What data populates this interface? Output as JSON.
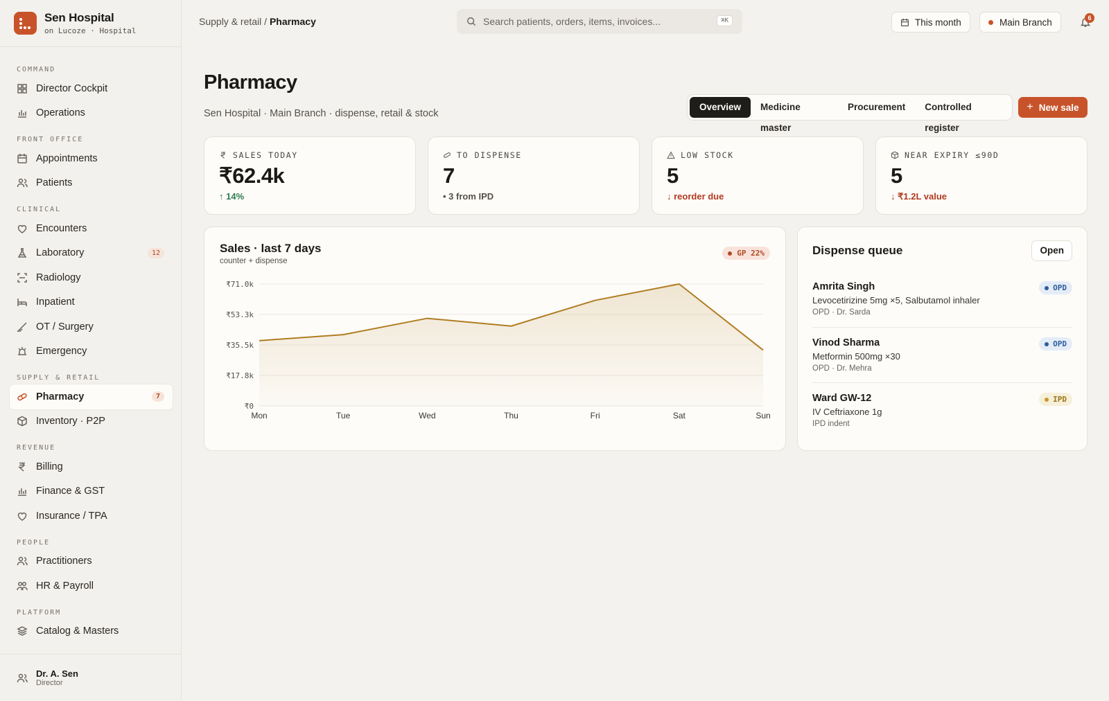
{
  "brand": {
    "name": "Sen Hospital",
    "subtitle": "on Lucoze · Hospital"
  },
  "sidebar": {
    "sections": [
      {
        "title": "COMMAND",
        "items": [
          {
            "label": "Director Cockpit",
            "icon": "grid-icon"
          },
          {
            "label": "Operations",
            "icon": "bar-chart-icon"
          }
        ]
      },
      {
        "title": "FRONT OFFICE",
        "items": [
          {
            "label": "Appointments",
            "icon": "calendar-icon"
          },
          {
            "label": "Patients",
            "icon": "users-icon"
          }
        ]
      },
      {
        "title": "CLINICAL",
        "items": [
          {
            "label": "Encounters",
            "icon": "heart-icon"
          },
          {
            "label": "Laboratory",
            "icon": "flask-icon",
            "badge": "12"
          },
          {
            "label": "Radiology",
            "icon": "scan-icon"
          },
          {
            "label": "Inpatient",
            "icon": "bed-icon"
          },
          {
            "label": "OT / Surgery",
            "icon": "scalpel-icon"
          },
          {
            "label": "Emergency",
            "icon": "siren-icon"
          }
        ]
      },
      {
        "title": "SUPPLY & RETAIL",
        "items": [
          {
            "label": "Pharmacy",
            "icon": "pill-icon",
            "badge": "7",
            "active": true
          },
          {
            "label": "Inventory · P2P",
            "icon": "box-icon"
          }
        ]
      },
      {
        "title": "REVENUE",
        "items": [
          {
            "label": "Billing",
            "icon": "rupee-icon"
          },
          {
            "label": "Finance & GST",
            "icon": "bar-chart-icon"
          },
          {
            "label": "Insurance / TPA",
            "icon": "heart-icon"
          }
        ]
      },
      {
        "title": "PEOPLE",
        "items": [
          {
            "label": "Practitioners",
            "icon": "users-icon"
          },
          {
            "label": "HR & Payroll",
            "icon": "users-icon"
          }
        ]
      },
      {
        "title": "PLATFORM",
        "items": [
          {
            "label": "Catalog & Masters",
            "icon": "layers-icon"
          }
        ]
      }
    ],
    "user": {
      "name": "Dr. A. Sen",
      "role": "Director"
    }
  },
  "topbar": {
    "breadcrumb_parent": "Supply & retail / ",
    "breadcrumb_current": "Pharmacy",
    "search_placeholder": "Search patients, orders, items, invoices...",
    "search_shortcut": "⌘K",
    "period_label": "This month",
    "branch_label": "Main Branch",
    "notification_count": "6"
  },
  "page": {
    "title": "Pharmacy",
    "subtitle": "Sen Hospital · Main Branch · dispense, retail & stock",
    "tabs": [
      "Overview",
      "Medicine master",
      "Procurement",
      "Controlled register"
    ],
    "active_tab": "Overview",
    "new_sale_label": "New sale"
  },
  "kpis": [
    {
      "label": "SALES TODAY",
      "icon": "rupee-icon",
      "value": "₹62.4k",
      "foot": "↑ 14%",
      "tone": "up"
    },
    {
      "label": "TO DISPENSE",
      "icon": "pill-icon",
      "value": "7",
      "foot": "• 3 from IPD",
      "tone": "muted"
    },
    {
      "label": "LOW STOCK",
      "icon": "warning-icon",
      "value": "5",
      "foot": "↓ reorder due",
      "tone": "down"
    },
    {
      "label": "NEAR EXPIRY ≤90D",
      "icon": "box-icon",
      "value": "5",
      "foot": "↓ ₹1.2L value",
      "tone": "down"
    }
  ],
  "sales_chart": {
    "title": "Sales · last 7 days",
    "subtitle": "counter + dispense",
    "badge": "GP 22%",
    "accent": "#b07d22"
  },
  "chart_data": {
    "type": "area",
    "title": "Sales · last 7 days",
    "subtitle": "counter + dispense",
    "categories": [
      "Mon",
      "Tue",
      "Wed",
      "Thu",
      "Fri",
      "Sat",
      "Sun"
    ],
    "values": [
      38000,
      41500,
      51000,
      46500,
      61500,
      71000,
      32500
    ],
    "y_ticks": [
      "₹0",
      "₹17.8k",
      "₹35.5k",
      "₹53.3k",
      "₹71.0k"
    ],
    "y_tick_values": [
      0,
      17800,
      35500,
      53300,
      71000
    ],
    "ylim": [
      0,
      71000
    ],
    "grid": true
  },
  "dispense_queue": {
    "title": "Dispense queue",
    "open_label": "Open",
    "items": [
      {
        "name": "Amrita Singh",
        "desc": "Levocetirizine 5mg ×5, Salbutamol inhaler",
        "meta": "OPD · Dr. Sarda",
        "tag": "OPD"
      },
      {
        "name": "Vinod Sharma",
        "desc": "Metformin 500mg ×30",
        "meta": "OPD · Dr. Mehra",
        "tag": "OPD"
      },
      {
        "name": "Ward GW-12",
        "desc": "IV Ceftriaxone 1g",
        "meta": "IPD indent",
        "tag": "IPD"
      }
    ]
  }
}
